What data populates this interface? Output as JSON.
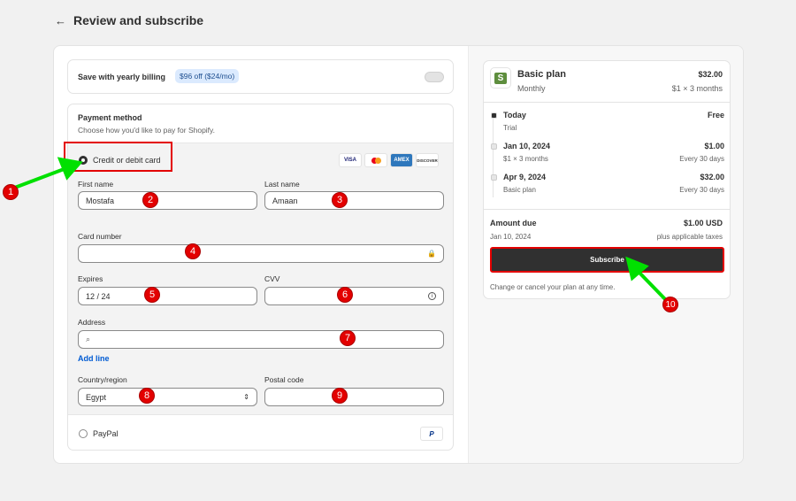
{
  "header": {
    "back_icon": "arrow-left-icon",
    "title": "Review and subscribe"
  },
  "yearly": {
    "label": "Save with yearly billing",
    "badge": "$96 off ($24/mo)"
  },
  "payment": {
    "title": "Payment method",
    "subtitle": "Choose how you'd like to pay for Shopify.",
    "card_option": "Credit or debit card",
    "card_brands": [
      "VISA",
      "MC",
      "AMEX",
      "DISCOVER"
    ],
    "first_name": {
      "label": "First name",
      "value": "Mostafa"
    },
    "last_name": {
      "label": "Last name",
      "value": "Amaan"
    },
    "card_number": {
      "label": "Card number",
      "value": ""
    },
    "expires": {
      "label": "Expires",
      "value": "12 / 24"
    },
    "cvv": {
      "label": "CVV",
      "value": ""
    },
    "address": {
      "label": "Address",
      "value": ""
    },
    "add_line": "Add line",
    "country": {
      "label": "Country/region",
      "value": "Egypt"
    },
    "postal": {
      "label": "Postal code",
      "value": ""
    },
    "paypal": "PayPal",
    "paypal_logo": "P"
  },
  "summary": {
    "plan": "Basic plan",
    "period": "Monthly",
    "price": "$32.00",
    "price_sub": "$1 × 3 months",
    "timeline": [
      {
        "date": "Today",
        "sub": "Trial",
        "amount": "Free",
        "amount_sub": ""
      },
      {
        "date": "Jan 10, 2024",
        "sub": "$1 × 3 months",
        "amount": "$1.00",
        "amount_sub": "Every 30 days"
      },
      {
        "date": "Apr 9, 2024",
        "sub": "Basic plan",
        "amount": "$32.00",
        "amount_sub": "Every 30 days"
      }
    ],
    "amount_due_label": "Amount due",
    "amount_due_date": "Jan 10, 2024",
    "amount_due": "$1.00 USD",
    "taxes": "plus applicable taxes",
    "subscribe": "Subscribe",
    "note": "Change or cancel your plan at any time.",
    "logo_letter": "S"
  },
  "annotations": [
    "1",
    "2",
    "3",
    "4",
    "5",
    "6",
    "7",
    "8",
    "9",
    "10"
  ],
  "colors": {
    "annotation": "#e30000",
    "arrow": "#00e000",
    "button": "#303030",
    "link": "#005bd3"
  }
}
